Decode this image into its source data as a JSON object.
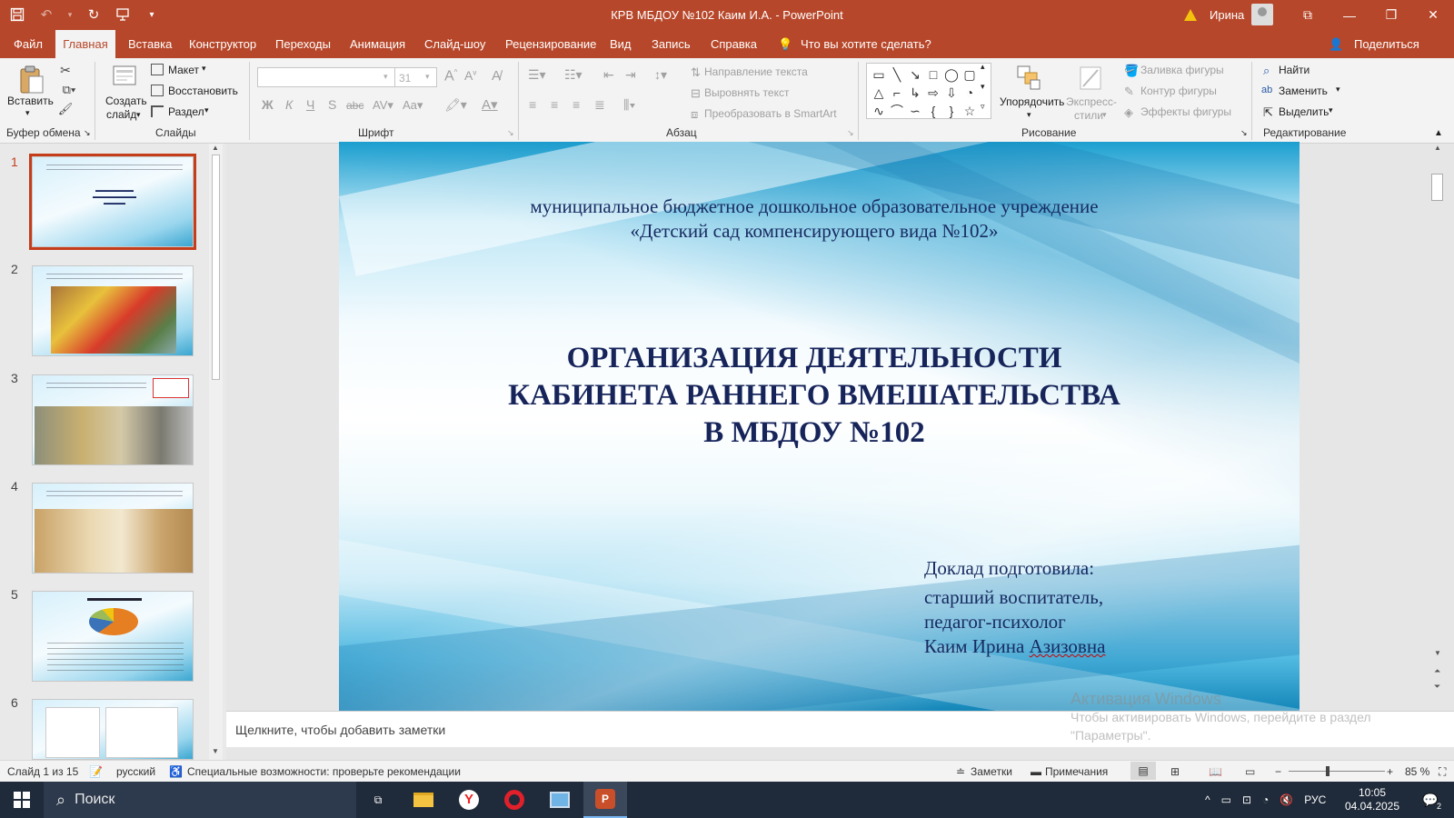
{
  "window": {
    "title": "КРВ МБДОУ №102 Каим И.А.  -  PowerPoint",
    "user_name": "Ирина",
    "controls": [
      "minimize-icon",
      "restore-icon",
      "close-icon"
    ]
  },
  "menu": {
    "file": "Файл",
    "tabs": [
      "Главная",
      "Вставка",
      "Конструктор",
      "Переходы",
      "Анимация",
      "Слайд-шоу",
      "Рецензирование",
      "Вид",
      "Запись",
      "Справка"
    ],
    "tell_me": "Что вы хотите сделать?",
    "share": "Поделиться"
  },
  "ribbon": {
    "clipboard": {
      "paste": "Вставить",
      "label": "Буфер обмена"
    },
    "slides": {
      "new_slide_line1": "Создать",
      "new_slide_line2": "слайд",
      "layout": "Макет",
      "reset": "Восстановить",
      "section": "Раздел",
      "label": "Слайды"
    },
    "font": {
      "font_name": "",
      "font_size": "31",
      "bold": "Ж",
      "italic": "К",
      "underline": "Ч",
      "shadow": "S",
      "strike": "abc",
      "label": "Шрифт"
    },
    "paragraph": {
      "text_direction": "Направление текста",
      "align_text": "Выровнять текст",
      "smartart": "Преобразовать в SmartArt",
      "label": "Абзац"
    },
    "drawing": {
      "arrange": "Упорядочить",
      "quick_styles_line1": "Экспресс-",
      "quick_styles_line2": "стили",
      "shape_fill": "Заливка фигуры",
      "shape_outline": "Контур фигуры",
      "shape_effects": "Эффекты фигуры",
      "label": "Рисование"
    },
    "editing": {
      "find": "Найти",
      "replace": "Заменить",
      "select": "Выделить",
      "label": "Редактирование"
    }
  },
  "thumbnails": [
    {
      "num": "1",
      "selected": true
    },
    {
      "num": "2",
      "selected": false
    },
    {
      "num": "3",
      "selected": false
    },
    {
      "num": "4",
      "selected": false
    },
    {
      "num": "5",
      "selected": false
    },
    {
      "num": "6",
      "selected": false
    }
  ],
  "slide": {
    "org_line1": "муниципальное бюджетное дошкольное образовательное учреждение",
    "org_line2": "«Детский сад компенсирующего вида №102»",
    "title_line1": "ОРГАНИЗАЦИЯ ДЕЯТЕЛЬНОСТИ",
    "title_line2": "КАБИНЕТА РАННЕГО ВМЕШАТЕЛЬСТВА",
    "title_line3": "В МБДОУ №102",
    "author_line1": "Доклад подготовила:",
    "author_line2": "старший воспитатель,",
    "author_line3": "педагог-психолог",
    "author_name_part1": "Каим Ирина ",
    "author_name_part2": "Азизовна"
  },
  "notes_placeholder": "Щелкните, чтобы добавить заметки",
  "activation": {
    "heading": "Активация Windows",
    "line1": "Чтобы активировать Windows, перейдите в раздел",
    "line2": "\"Параметры\"."
  },
  "statusbar": {
    "slide_count": "Слайд 1 из 15",
    "language": "русский",
    "accessibility": "Специальные возможности: проверьте рекомендации",
    "notes": "Заметки",
    "comments": "Примечания",
    "zoom": "85 %"
  },
  "taskbar": {
    "search": "Поиск",
    "lang": "РУС",
    "time": "10:05",
    "date": "04.04.2025",
    "notifications": "2"
  },
  "colors": {
    "accent": "#b7472a",
    "slide_text": "#172b62",
    "taskbar": "#1f2a3a"
  }
}
